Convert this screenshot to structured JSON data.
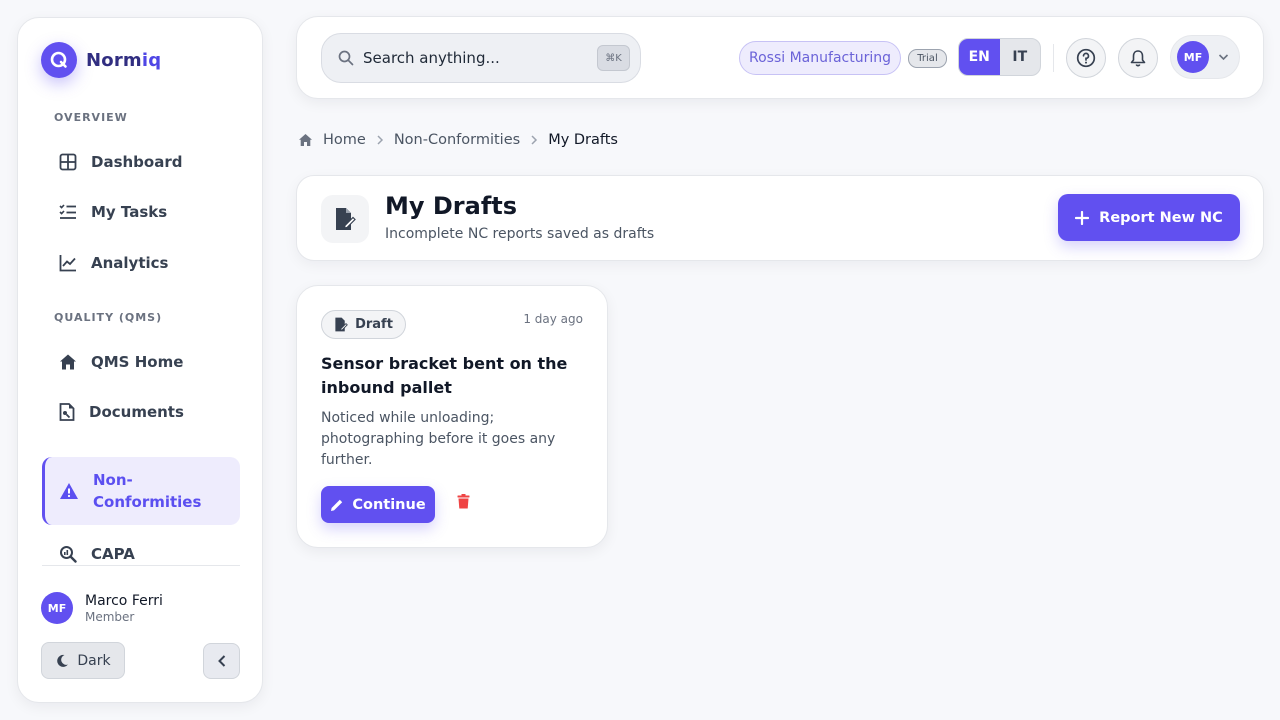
{
  "app": {
    "name_part1": "Norm",
    "name_part2": "iq"
  },
  "sidebar": {
    "sections": [
      {
        "label": "OVERVIEW"
      },
      {
        "label": "QUALITY (QMS)"
      }
    ],
    "items": [
      {
        "label": "Dashboard",
        "icon": "dashboard-icon"
      },
      {
        "label": "My Tasks",
        "icon": "tasks-icon"
      },
      {
        "label": "Analytics",
        "icon": "analytics-icon"
      },
      {
        "label": "QMS Home",
        "icon": "home-icon"
      },
      {
        "label": "Documents",
        "icon": "documents-icon"
      },
      {
        "label": "Non-Conformities",
        "label_line1": "Non-",
        "label_line2": "Conformities",
        "icon": "warning-icon",
        "active": true
      },
      {
        "label": "CAPA",
        "icon": "capa-icon"
      }
    ],
    "user": {
      "initials": "MF",
      "name": "Marco Ferri",
      "role": "Member"
    },
    "theme_toggle_label": "Dark"
  },
  "header": {
    "search_placeholder": "Search anything...",
    "search_shortcut": "⌘K",
    "organization": "Rossi Manufacturing",
    "plan_badge": "Trial",
    "languages": [
      {
        "code": "EN",
        "active": true
      },
      {
        "code": "IT",
        "active": false
      }
    ],
    "avatar_initials": "MF"
  },
  "breadcrumb": {
    "items": [
      "Home",
      "Non-Conformities",
      "My Drafts"
    ]
  },
  "page": {
    "title": "My Drafts",
    "subtitle": "Incomplete NC reports saved as drafts",
    "primary_action": "Report New NC"
  },
  "drafts": [
    {
      "badge": "Draft",
      "time": "1 day ago",
      "title": "Sensor bracket bent on the inbound pallet",
      "description": "Noticed while unloading; photographing before it goes any further.",
      "continue_label": "Continue"
    }
  ],
  "colors": {
    "accent": "#6150f0",
    "accent_soft": "#eeecfd",
    "danger": "#ef4444",
    "background": "#f7f8fb"
  }
}
